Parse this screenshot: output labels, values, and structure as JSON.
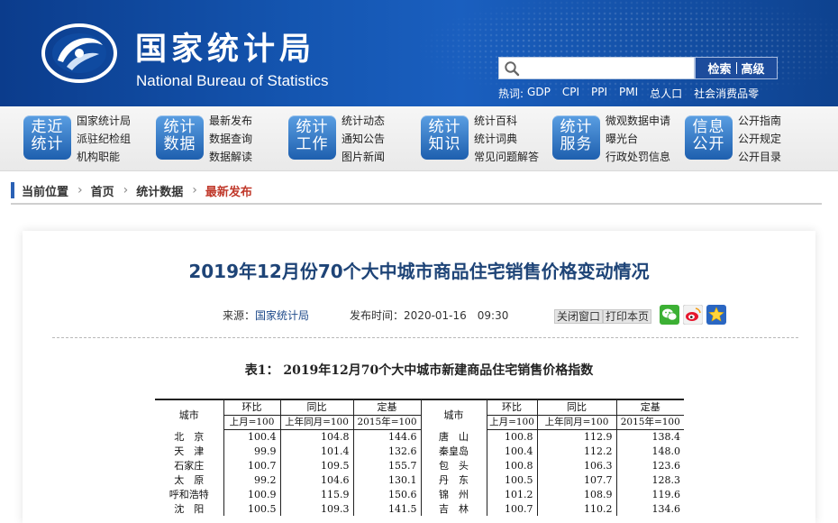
{
  "site": {
    "name_cn": "国家统计局",
    "name_en": "National Bureau of Statistics"
  },
  "search": {
    "value": "",
    "placeholder": "",
    "search_label": "检索",
    "advanced_label": "高级"
  },
  "hotwords": {
    "label": "热词:",
    "items": [
      "GDP",
      "CPI",
      "PPI",
      "PMI",
      "总人口",
      "社会消费品零"
    ]
  },
  "nav": [
    {
      "badge": [
        "走近",
        "统计"
      ],
      "links": [
        "国家统计局",
        "派驻纪检组",
        "机构职能"
      ]
    },
    {
      "badge": [
        "统计",
        "数据"
      ],
      "links": [
        "最新发布",
        "数据查询",
        "数据解读"
      ]
    },
    {
      "badge": [
        "统计",
        "工作"
      ],
      "links": [
        "统计动态",
        "通知公告",
        "图片新闻"
      ]
    },
    {
      "badge": [
        "统计",
        "知识"
      ],
      "links": [
        "统计百科",
        "统计词典",
        "常见问题解答"
      ]
    },
    {
      "badge": [
        "统计",
        "服务"
      ],
      "links": [
        "微观数据申请",
        "曝光台",
        "行政处罚信息"
      ]
    },
    {
      "badge": [
        "信息",
        "公开"
      ],
      "links": [
        "公开指南",
        "公开规定",
        "公开目录"
      ]
    }
  ],
  "breadcrumb": {
    "items": [
      "当前位置",
      "首页",
      "统计数据",
      "最新发布"
    ]
  },
  "article": {
    "title": "2019年12月份70个大中城市商品住宅销售价格变动情况",
    "source_label": "来源：",
    "source": "国家统计局",
    "pubtime_label": "发布时间：",
    "pubtime": "2020-01-16　09:30",
    "close_label": "关闭窗口",
    "print_label": "打印本页",
    "share_icons": [
      "wechat-icon",
      "weibo-icon",
      "favorite-star-icon"
    ],
    "colors": {
      "title": "#1e4477",
      "crumb_current": "#c0392b",
      "header_bg": "#1455b0"
    }
  },
  "table": {
    "title": "表1：  2019年12月70个大中城市新建商品住宅销售价格指数",
    "headers": {
      "city": "城市",
      "mom": "环比",
      "yoy": "同比",
      "fixed": "定基",
      "mom_base": "上月=100",
      "yoy_base": "上年同月=100",
      "fixed_base": "2015年=100"
    },
    "rows": [
      {
        "left": [
          "北　京",
          "100.4",
          "104.8",
          "144.6"
        ],
        "right": [
          "唐　山",
          "100.8",
          "112.9",
          "138.4"
        ]
      },
      {
        "left": [
          "天　津",
          "99.9",
          "101.4",
          "132.6"
        ],
        "right": [
          "秦皇岛",
          "100.4",
          "112.2",
          "148.0"
        ]
      },
      {
        "left": [
          "石家庄",
          "100.7",
          "109.5",
          "155.7"
        ],
        "right": [
          "包　头",
          "100.8",
          "106.3",
          "123.6"
        ]
      },
      {
        "left": [
          "太　原",
          "99.2",
          "104.6",
          "130.1"
        ],
        "right": [
          "丹　东",
          "100.5",
          "107.7",
          "128.3"
        ]
      },
      {
        "left": [
          "呼和浩特",
          "100.9",
          "115.9",
          "150.6"
        ],
        "right": [
          "锦　州",
          "101.2",
          "108.9",
          "119.6"
        ]
      },
      {
        "left": [
          "沈　阳",
          "100.5",
          "109.3",
          "141.5"
        ],
        "right": [
          "吉　林",
          "100.7",
          "110.2",
          "134.6"
        ]
      }
    ]
  }
}
